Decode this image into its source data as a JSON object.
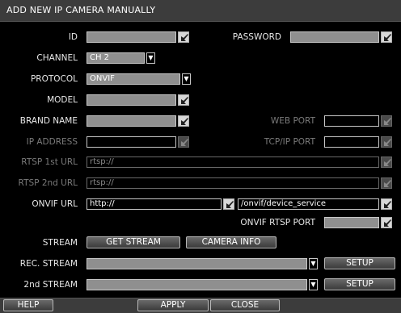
{
  "title": "ADD NEW IP CAMERA MANUALLY",
  "labels": {
    "id": "ID",
    "password": "PASSWORD",
    "channel": "CHANNEL",
    "protocol": "PROTOCOL",
    "model": "MODEL",
    "brand_name": "BRAND NAME",
    "web_port": "WEB PORT",
    "ip_address": "IP ADDRESS",
    "tcpip_port": "TCP/IP PORT",
    "rtsp1": "RTSP 1st URL",
    "rtsp2": "RTSP 2nd URL",
    "onvif_url": "ONVIF URL",
    "onvif_rtsp_port": "ONVIF RTSP PORT",
    "stream": "STREAM",
    "rec_stream": "REC. STREAM",
    "second_stream": "2nd STREAM"
  },
  "fields": {
    "id": "",
    "password": "",
    "channel": "CH 2",
    "protocol": "ONVIF",
    "model": "",
    "brand_name": "",
    "web_port": "",
    "ip_address": "",
    "tcpip_port": "",
    "rtsp1": "rtsp://",
    "rtsp2": "rtsp://",
    "onvif_url_prefix": "http://",
    "onvif_url_path": "/onvif/device_service",
    "onvif_rtsp_port": "",
    "rec_stream": "",
    "second_stream": ""
  },
  "buttons": {
    "get_stream": "GET STREAM",
    "camera_info": "CAMERA INFO",
    "setup_rec": "SETUP",
    "setup_2nd": "SETUP",
    "help": "HELP",
    "apply": "APPLY",
    "close": "CLOSE"
  },
  "icons": {
    "keyboard": "keyboard-pencil-icon",
    "dropdown": "dropdown-arrow-icon"
  },
  "colors": {
    "background": "#000000",
    "title_bar": "#3c3c3c",
    "input_fill": "#8f8f8f",
    "disabled_text": "#7a7a7a"
  }
}
